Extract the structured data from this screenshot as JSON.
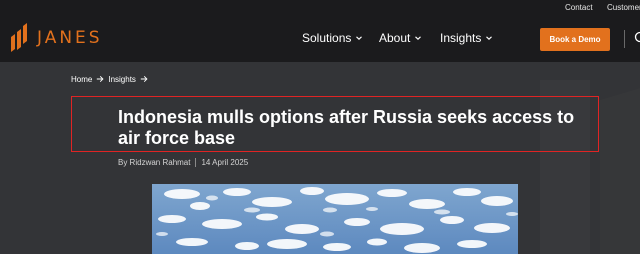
{
  "utility_nav": {
    "contact": "Contact",
    "customer": "Customer"
  },
  "brand": {
    "name": "JANES",
    "accent_color": "#e2711d"
  },
  "main_nav": {
    "solutions": "Solutions",
    "about": "About",
    "insights": "Insights",
    "book_demo": "Book a Demo"
  },
  "icons": {
    "nav_chevron": "chevron-down-icon",
    "breadcrumb_arrow": "arrow-right-icon",
    "search": "search-icon"
  },
  "breadcrumb": {
    "home": "Home",
    "insights": "Insights"
  },
  "article": {
    "title": "Indonesia mulls options after Russia seeks access to air force base",
    "author": "By Ridzwan Rahmat",
    "date": "14 April 2025",
    "highlight_color": "#e02424"
  }
}
